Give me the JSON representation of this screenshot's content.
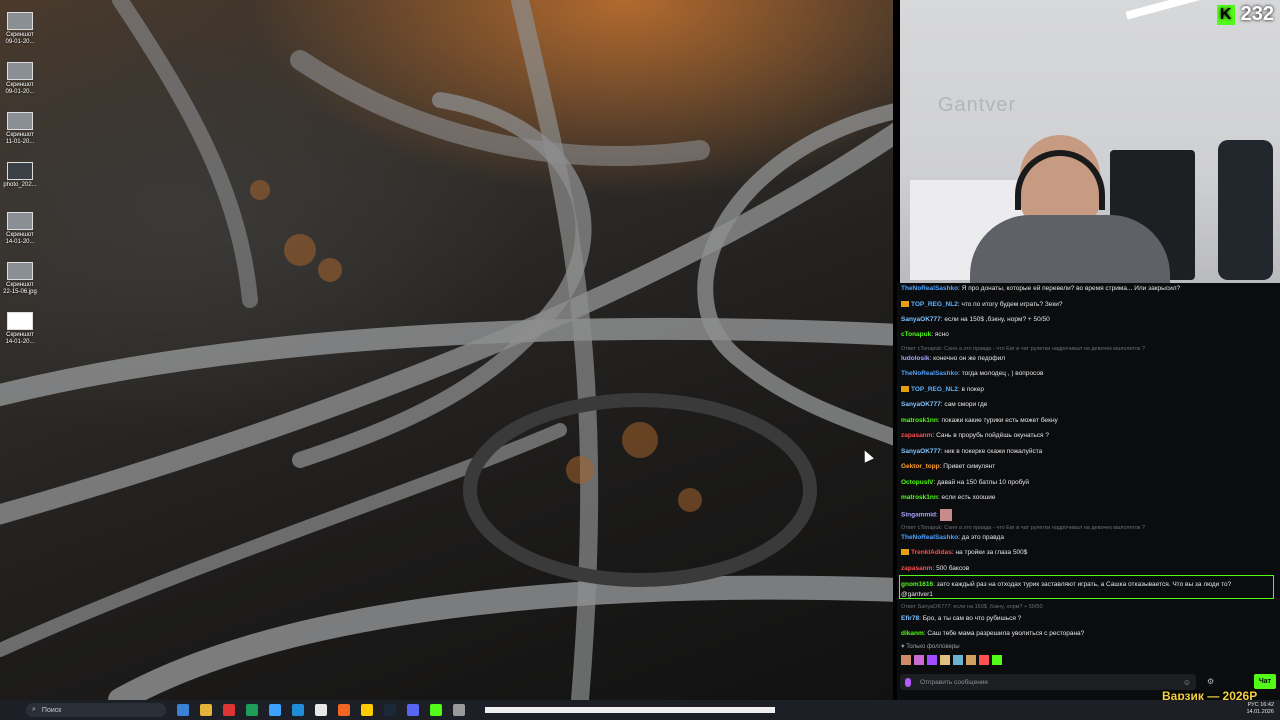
{
  "desktop": {
    "icons": [
      {
        "label": "Скриншот 09-01-20..."
      },
      {
        "label": "Скриншот 09-01-20..."
      },
      {
        "label": "Скриншот 11-01-20..."
      },
      {
        "label": "photo_202..."
      },
      {
        "label": "Скриншот 14-01-20..."
      },
      {
        "label": "Скриншот 22-15-06.jpg"
      },
      {
        "label": "Скриншот 14-01-20..."
      }
    ]
  },
  "webcam": {
    "wall_sign": "Gantver",
    "viewer_count": "232",
    "kick_logo": "K"
  },
  "chat": {
    "messages": [
      {
        "user": "TheNoRealSashko",
        "text": "Я про донаты, которые ей перевели? во время стрима... Или закрысил?",
        "color": "#4fa3ff"
      },
      {
        "user": "TOP_REG_NL2",
        "text": "что по итогу будем играть? Зеки?",
        "color": "#5ab4ff",
        "badge": true
      },
      {
        "user": "SanyaOK777",
        "text": "если на 150$ ,бэкну, норм? + 50/50",
        "color": "#7ec3ff"
      },
      {
        "user": "cTonapuk",
        "text": "ясно",
        "color": "#53fc18"
      },
      {
        "reply": "Ответ cTonapuk: Саня а это правда - что Евг в чат рулетки надрочивал на девочек малолеток ?"
      },
      {
        "user": "ludolosik",
        "text": "конечно он же педофил",
        "color": "#a7a7ff"
      },
      {
        "user": "TheNoRealSashko",
        "text": "тогда молодец , ) вопросов",
        "color": "#4fa3ff"
      },
      {
        "user": "TOP_REG_NL2",
        "text": "в покер",
        "color": "#5ab4ff",
        "badge": true
      },
      {
        "user": "SanyaOK777",
        "text": "сам смори где",
        "color": "#7ec3ff"
      },
      {
        "user": "matrosk1nn",
        "text": "покажи какие турики есть может бекну",
        "color": "#53fc18"
      },
      {
        "user": "zapasanm",
        "text": "Сань в прорубь пойдёшь окунаться ?",
        "color": "#ff4d4d"
      },
      {
        "user": "SanyaOK777",
        "text": "ник в покерке скажи пожалуйста",
        "color": "#7ec3ff"
      },
      {
        "user": "Gektor_topp",
        "text": "Привет симулянт",
        "color": "#ff9f2e"
      },
      {
        "user": "OctopusIV",
        "text": "давай на 150 батлы 10 пробуй",
        "color": "#53fc18"
      },
      {
        "user": "matrosk1nn",
        "text": "если есть хоошие",
        "color": "#53fc18"
      },
      {
        "user": "Singammid",
        "text": "",
        "color": "#a7a7ff",
        "emote": true
      },
      {
        "reply": "Ответ cTonapuk: Саня а это правда - что Евг в чат рулетки надрочивал на девочек малолеток ?"
      },
      {
        "user": "TheNoRealSashko",
        "text": "да это правда",
        "color": "#4fa3ff"
      },
      {
        "user": "TrenkIAdidas",
        "text": "на тройки за глаза 500$",
        "color": "#ff4d4d",
        "badge": true
      },
      {
        "user": "zapasanm",
        "text": "500 баксов",
        "color": "#ff4d4d"
      },
      {
        "user": "gnom1616",
        "text": "зато каждый раз на отходах турик заставляют играть, а Сашка отказывается. Что вы за люди то?",
        "color": "#53fc18",
        "second": "@gantver1"
      },
      {
        "reply": "Ответ SanyaOK777: если на 150$ ,бэкну, норм? + 50/50"
      },
      {
        "user": "Efir78",
        "text": "Бро, а ты сам во что рубишься ?",
        "color": "#7ec3ff"
      },
      {
        "user": "dikanm",
        "text": "Саш тебе мама разрешила уволиться с ресторана?",
        "color": "#53fc18"
      }
    ],
    "followers_only": "Только фолловеры",
    "input_placeholder": "Отправить сообщение",
    "send_label": "Чат",
    "stream_overlay": "Варзик — 2026Р"
  },
  "taskbar": {
    "search_placeholder": "Поиск",
    "language": "РУС",
    "time": "16:42",
    "date": "14.01.2026"
  },
  "colors": {
    "kick_green": "#53fc18",
    "chat_bg": "#0b0c0e",
    "taskbar_bg": "#1c1f26"
  }
}
